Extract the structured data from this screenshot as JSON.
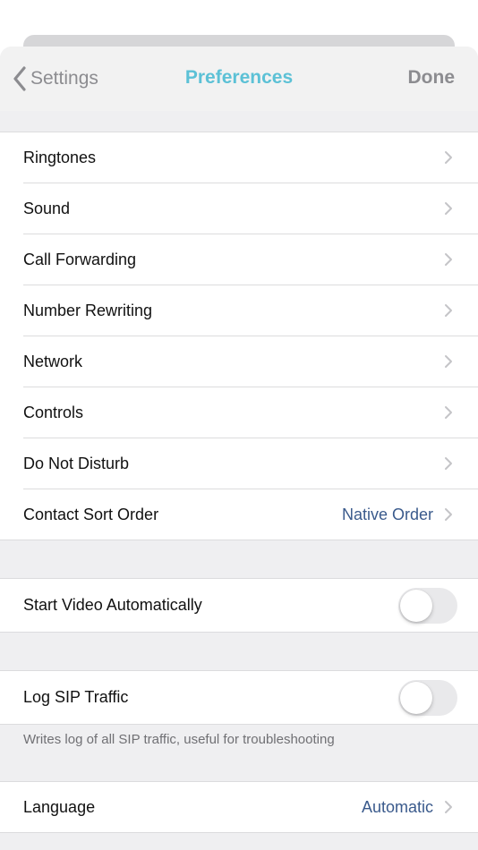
{
  "navbar": {
    "back_label": "Settings",
    "title": "Preferences",
    "done_label": "Done"
  },
  "preferences_group": [
    {
      "label": "Ringtones",
      "value": ""
    },
    {
      "label": "Sound",
      "value": ""
    },
    {
      "label": "Call Forwarding",
      "value": ""
    },
    {
      "label": "Number Rewriting",
      "value": ""
    },
    {
      "label": "Network",
      "value": ""
    },
    {
      "label": "Controls",
      "value": ""
    },
    {
      "label": "Do Not Disturb",
      "value": ""
    },
    {
      "label": "Contact Sort Order",
      "value": "Native Order"
    }
  ],
  "video": {
    "label": "Start Video Automatically",
    "enabled": false
  },
  "sip_log": {
    "label": "Log SIP Traffic",
    "enabled": false,
    "footer": "Writes log of all SIP traffic, useful for troubleshooting"
  },
  "language": {
    "label": "Language",
    "value": "Automatic"
  },
  "colors": {
    "accent_title": "#5cc1d6",
    "value_text": "#3a5a8c",
    "nav_gray": "#8c8c90",
    "background": "#efeff1"
  },
  "icons": [
    "chevron-left-icon",
    "chevron-right-icon"
  ]
}
